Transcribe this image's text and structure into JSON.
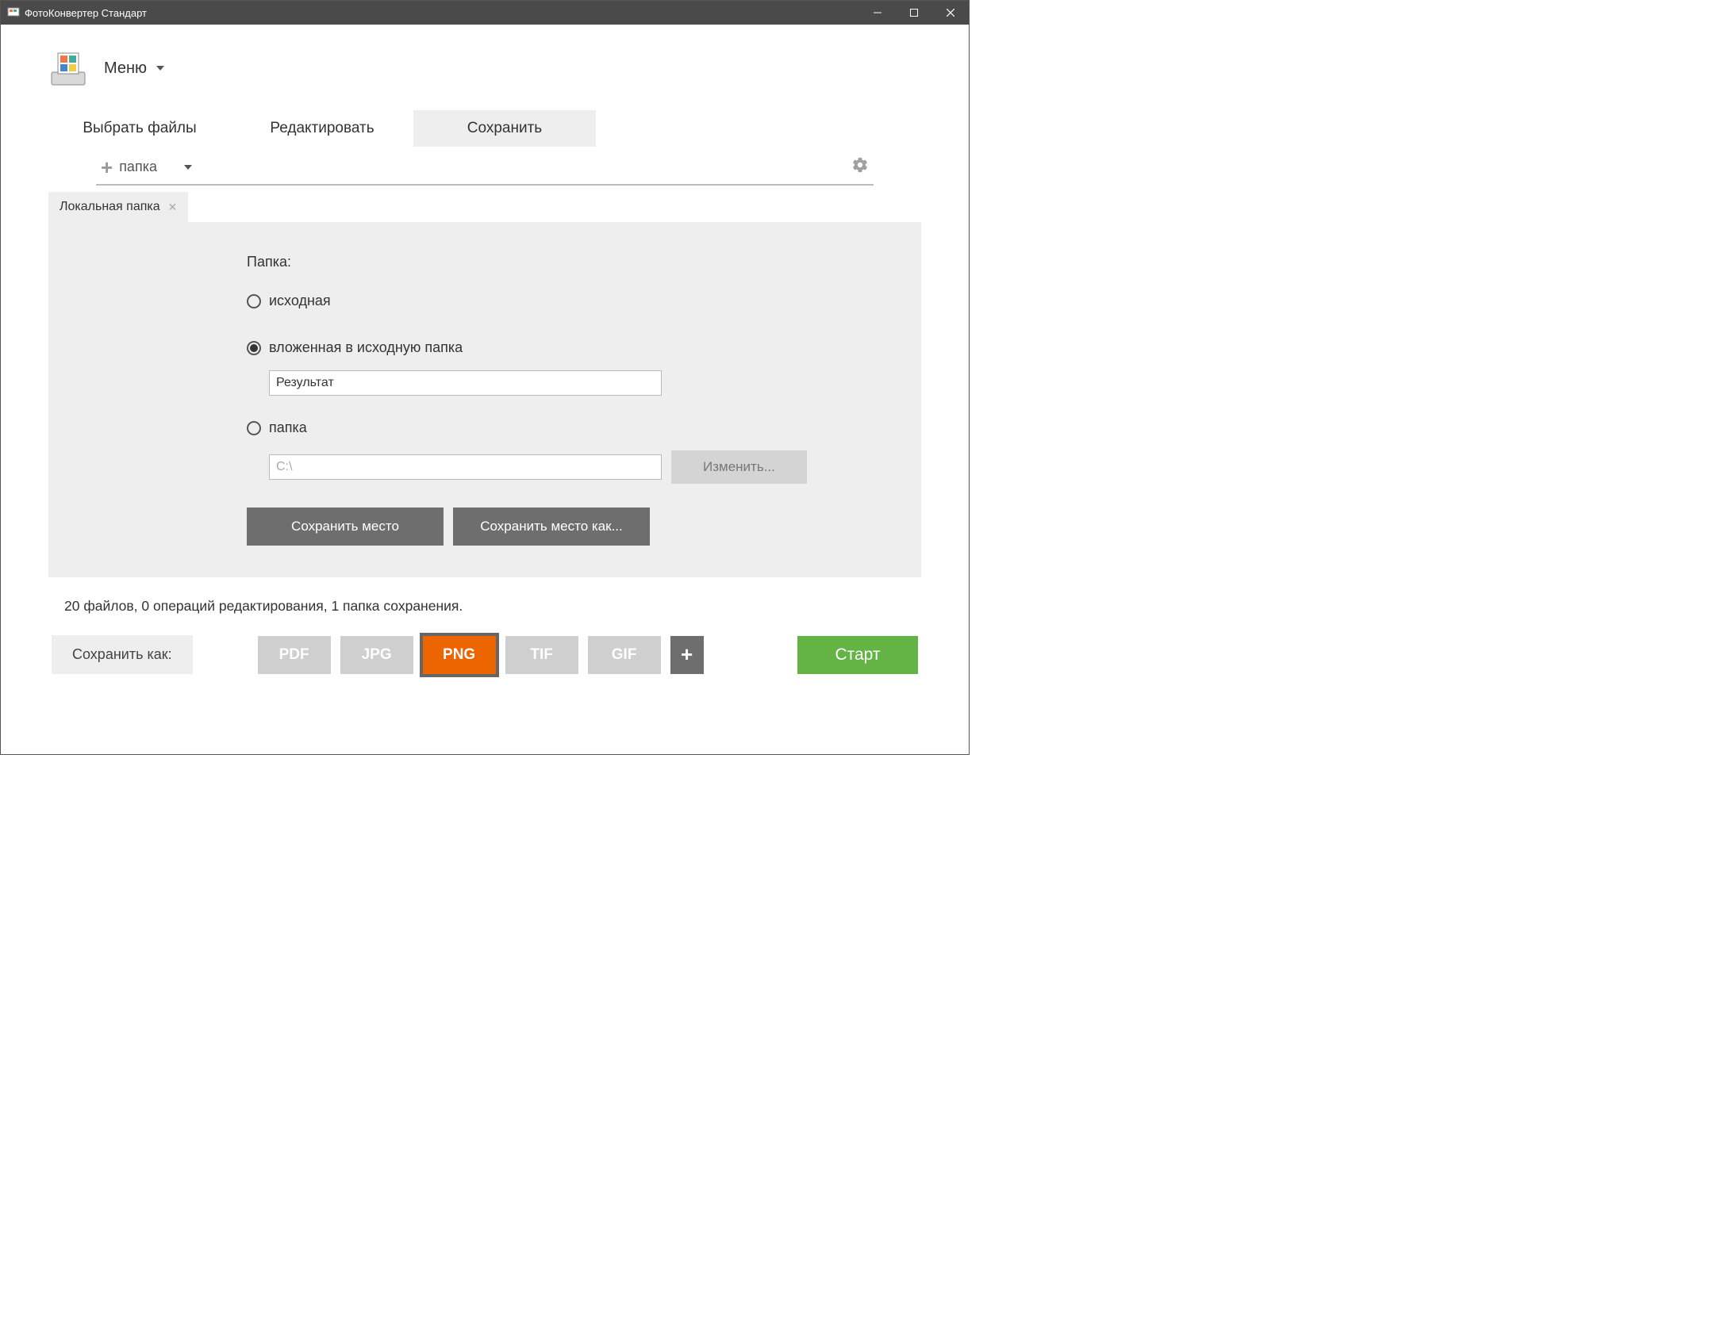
{
  "window": {
    "title": "ФотоКонвертер Стандарт"
  },
  "header": {
    "menu_label": "Меню"
  },
  "tabs": {
    "items": [
      {
        "label": "Выбрать файлы"
      },
      {
        "label": "Редактировать"
      },
      {
        "label": "Сохранить"
      }
    ]
  },
  "toolbar": {
    "add_label": "папка"
  },
  "subtab": {
    "label": "Локальная папка"
  },
  "panel": {
    "folder_label": "Папка:",
    "radio_source": "исходная",
    "radio_subfolder": "вложенная в исходную папка",
    "subfolder_value": "Результат",
    "radio_folder": "папка",
    "folder_value": "C:\\",
    "change_btn": "Изменить...",
    "save_place": "Сохранить место",
    "save_place_as": "Сохранить место как..."
  },
  "status": {
    "text": "20 файлов, 0 операций редактирования, 1 папка сохранения."
  },
  "bottom": {
    "save_as_label": "Сохранить как:",
    "formats": [
      "PDF",
      "JPG",
      "PNG",
      "TIF",
      "GIF"
    ],
    "selected_format": "PNG",
    "start_label": "Старт"
  }
}
